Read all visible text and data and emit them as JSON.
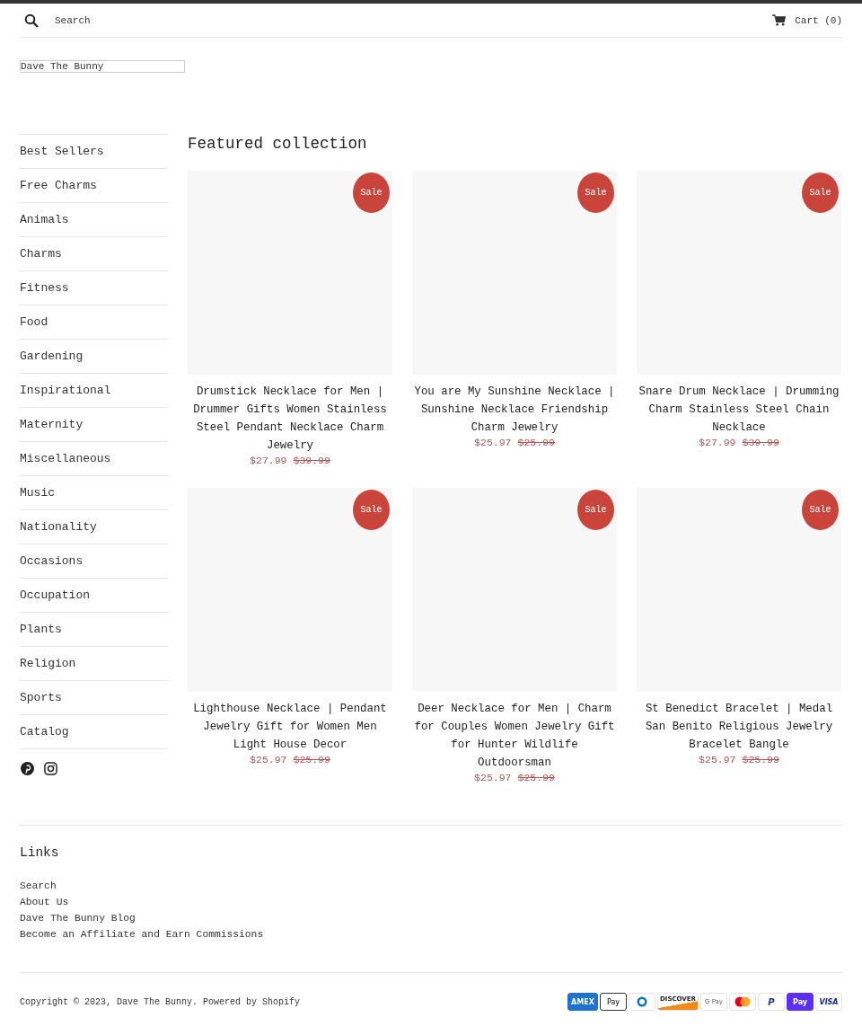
{
  "header": {
    "search": {
      "placeholder": "Search"
    },
    "cart": "Cart (0)"
  },
  "logo": "Dave The Bunny",
  "sidebar": {
    "items": [
      {
        "label": "Best Sellers"
      },
      {
        "label": "Free Charms"
      },
      {
        "label": "Animals"
      },
      {
        "label": "Charms"
      },
      {
        "label": "Fitness"
      },
      {
        "label": "Food"
      },
      {
        "label": "Gardening"
      },
      {
        "label": "Inspirational"
      },
      {
        "label": "Maternity"
      },
      {
        "label": "Miscellaneous"
      },
      {
        "label": "Music"
      },
      {
        "label": "Nationality"
      },
      {
        "label": "Occasions"
      },
      {
        "label": "Occupation"
      },
      {
        "label": "Plants"
      },
      {
        "label": "Religion"
      },
      {
        "label": "Sports"
      },
      {
        "label": "Catalog"
      }
    ],
    "social": [
      {
        "kind": "pinterest"
      },
      {
        "kind": "instagram"
      }
    ]
  },
  "collection": {
    "title": "Featured collection",
    "products": [
      {
        "badge": "Sale",
        "title": "Drumstick Necklace for Men | Drummer Gifts Women Stainless Steel Pendant Necklace Charm Jewelry",
        "price": "$27.99",
        "compare_price": "$39.99"
      },
      {
        "badge": "Sale",
        "title": "You are My Sunshine Necklace | Sunshine Necklace Friendship Charm Jewelry",
        "price": "$25.97",
        "compare_price": "$25.99"
      },
      {
        "badge": "Sale",
        "title": "Snare Drum Necklace | Drumming Charm Stainless Steel Chain Necklace",
        "price": "$27.99",
        "compare_price": "$39.99"
      },
      {
        "badge": "Sale",
        "title": "Lighthouse Necklace | Pendant Jewelry Gift for Women Men Light House Decor",
        "price": "$25.97",
        "compare_price": "$25.99"
      },
      {
        "badge": "Sale",
        "title": "Deer Necklace for Men | Charm for Couples Women Jewelry Gift for Hunter Wildlife Outdoorsman",
        "price": "$25.97",
        "compare_price": "$25.99"
      },
      {
        "badge": "Sale",
        "title": "St Benedict Bracelet | Medal San Benito Religious Jewelry Bracelet Bangle",
        "price": "$25.97",
        "compare_price": "$25.99"
      }
    ]
  },
  "footer": {
    "links_title": "Links",
    "links": [
      "Search",
      "About Us",
      "Dave The Bunny Blog",
      "Become an Affiliate and Earn Commissions"
    ],
    "copyright": "Copyright © 2023, Dave The Bunny. Powered by Shopify",
    "payment_methods": [
      {
        "kind": "amex",
        "label": "AMEX"
      },
      {
        "kind": "applepay",
        "label": "Pay"
      },
      {
        "kind": "diners"
      },
      {
        "kind": "discover",
        "label": "DISCOVER"
      },
      {
        "kind": "gpay",
        "label": "G Pay"
      },
      {
        "kind": "mastercard"
      },
      {
        "kind": "paypal",
        "label": "P"
      },
      {
        "kind": "shoppay",
        "label": "Pay"
      },
      {
        "kind": "visa",
        "label": "VISA"
      }
    ]
  }
}
